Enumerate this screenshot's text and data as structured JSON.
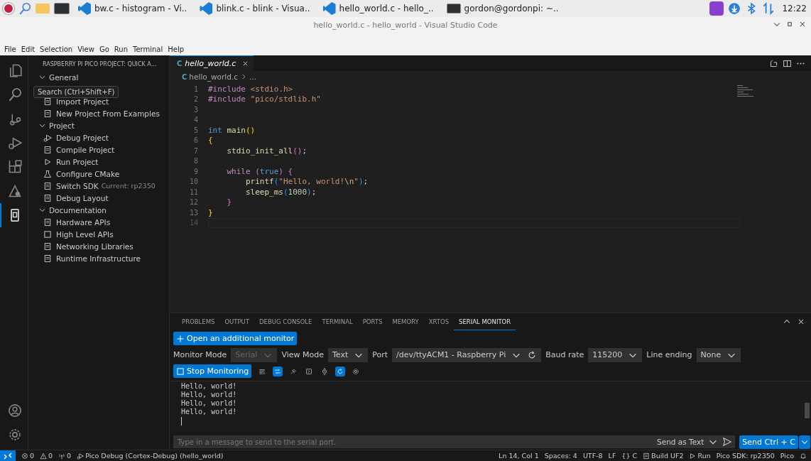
{
  "taskbar": {
    "windows": [
      {
        "kind": "vscode",
        "label": "bw.c - histogram - Vi.."
      },
      {
        "kind": "vscode",
        "label": "blink.c - blink - Visua.."
      },
      {
        "kind": "vscode",
        "label": "hello_world.c - hello_.."
      },
      {
        "kind": "terminal",
        "label": "gordon@gordonpi: ~.."
      }
    ],
    "clock": "12:22"
  },
  "window": {
    "title": "hello_world.c - hello_world - Visual Studio Code"
  },
  "menu": [
    "File",
    "Edit",
    "Selection",
    "View",
    "Go",
    "Run",
    "Terminal",
    "Help"
  ],
  "activity_bar": {
    "items": [
      {
        "selected": false
      },
      {
        "selected": false
      },
      {
        "selected": false
      },
      {
        "selected": false
      },
      {
        "selected": false
      },
      {
        "selected": false
      },
      {
        "selected": true
      }
    ],
    "tooltip": "Search (Ctrl+Shift+F)"
  },
  "sidebar": {
    "title": "RASPBERRY PI PICO PROJECT: QUICK A...",
    "sections": [
      {
        "label": "General",
        "expanded": true,
        "items": [
          {
            "label": "Import Project"
          },
          {
            "label": "New Project From Examples"
          }
        ]
      },
      {
        "label": "Project",
        "expanded": true,
        "items": [
          {
            "label": "Debug Project"
          },
          {
            "label": "Compile Project"
          },
          {
            "label": "Run Project"
          },
          {
            "label": "Configure CMake"
          },
          {
            "label": "Switch SDK",
            "detail": "Current: rp2350"
          },
          {
            "label": "Debug Layout"
          }
        ]
      },
      {
        "label": "Documentation",
        "expanded": true,
        "items": [
          {
            "label": "Hardware APIs"
          },
          {
            "label": "High Level APIs"
          },
          {
            "label": "Networking Libraries"
          },
          {
            "label": "Runtime Infrastructure"
          }
        ]
      }
    ]
  },
  "editor": {
    "tabs": [
      {
        "icon_text": "C",
        "label": "hello_world.c",
        "selected": true
      }
    ],
    "breadcrumb": {
      "icon_text": "C",
      "parts": [
        "hello_world.c",
        "..."
      ]
    },
    "lines": [
      {
        "number": "1",
        "current": false,
        "tokens": [
          {
            "kind": "directive",
            "text": "#include"
          },
          {
            "kind": "string",
            "text": " <stdio.h>"
          }
        ]
      },
      {
        "number": "2",
        "current": false,
        "tokens": [
          {
            "kind": "directive",
            "text": "#include"
          },
          {
            "kind": "string",
            "text": " \"pico/stdlib.h\""
          }
        ]
      },
      {
        "number": "3",
        "current": false
      },
      {
        "number": "4",
        "current": false
      },
      {
        "number": "5",
        "current": false,
        "tokens": [
          {
            "kind": "keyword",
            "text": "int"
          },
          {
            "kind": "function",
            "text": " main"
          },
          {
            "kind": "brace1",
            "text": "()"
          }
        ]
      },
      {
        "number": "6",
        "current": false,
        "tokens": [
          {
            "kind": "brace1",
            "text": "{"
          }
        ]
      },
      {
        "number": "7",
        "current": false,
        "tokens": [
          {
            "kind": "function",
            "text": "    stdio_init_all"
          },
          {
            "kind": "brace2",
            "text": "()"
          },
          {
            "kind": "plain",
            "text": ";"
          }
        ]
      },
      {
        "number": "8",
        "current": false
      },
      {
        "number": "9",
        "current": false,
        "tokens": [
          {
            "kind": "control",
            "text": "    while"
          },
          {
            "kind": "brace2",
            "text": " ("
          },
          {
            "kind": "keyword",
            "text": "true"
          },
          {
            "kind": "brace2",
            "text": ") {"
          }
        ]
      },
      {
        "number": "10",
        "current": false,
        "tokens": [
          {
            "kind": "function",
            "text": "        printf"
          },
          {
            "kind": "brace3",
            "text": "("
          },
          {
            "kind": "string",
            "text": "\"Hello, world!"
          },
          {
            "kind": "escape",
            "text": "\\n"
          },
          {
            "kind": "string",
            "text": "\""
          },
          {
            "kind": "brace3",
            "text": ")"
          },
          {
            "kind": "plain",
            "text": ";"
          }
        ]
      },
      {
        "number": "11",
        "current": false,
        "tokens": [
          {
            "kind": "function",
            "text": "        sleep_ms"
          },
          {
            "kind": "brace3",
            "text": "("
          },
          {
            "kind": "number",
            "text": "1000"
          },
          {
            "kind": "brace3",
            "text": ")"
          },
          {
            "kind": "plain",
            "text": ";"
          }
        ]
      },
      {
        "number": "12",
        "current": false,
        "tokens": [
          {
            "kind": "brace2",
            "text": "    }"
          }
        ]
      },
      {
        "number": "13",
        "current": false,
        "tokens": [
          {
            "kind": "brace1",
            "text": "}"
          }
        ]
      },
      {
        "number": "14",
        "current": true
      }
    ]
  },
  "panel": {
    "tabs": [
      {
        "label": "PROBLEMS",
        "selected": false
      },
      {
        "label": "OUTPUT",
        "selected": false
      },
      {
        "label": "DEBUG CONSOLE",
        "selected": false
      },
      {
        "label": "TERMINAL",
        "selected": false
      },
      {
        "label": "PORTS",
        "selected": false
      },
      {
        "label": "MEMORY",
        "selected": false
      },
      {
        "label": "XRTOS",
        "selected": false
      },
      {
        "label": "SERIAL MONITOR",
        "selected": true
      }
    ],
    "serial_monitor": {
      "open_button": "Open an additional monitor",
      "settings": [
        {
          "kind": "select",
          "label": "Monitor Mode",
          "value": "Serial",
          "disabled": true
        },
        {
          "kind": "select",
          "label": "View Mode",
          "value": "Text",
          "disabled": false
        },
        {
          "kind": "select_refresh",
          "label": "Port",
          "value": "/dev/ttyACM1 - Raspberry Pi",
          "disabled": false
        },
        {
          "kind": "select",
          "label": "Baud rate",
          "value": "115200",
          "disabled": false
        },
        {
          "kind": "select",
          "label": "Line ending",
          "value": "None",
          "disabled": false
        }
      ],
      "stop_button": "Stop Monitoring",
      "tools": [
        {
          "on": false
        },
        {
          "on": true
        },
        {
          "on": false
        },
        {
          "on": false
        },
        {
          "on": false
        },
        {
          "on": true
        },
        {
          "on": false
        }
      ],
      "output": [
        "Hello, world!",
        "Hello, world!",
        "Hello, world!",
        "Hello, world!"
      ],
      "input": {
        "placeholder": "Type in a message to send to the serial port."
      },
      "send_mode": "Send as Text",
      "send_button": "Send Ctrl + C"
    }
  },
  "status_bar": {
    "left": [
      {
        "kind": "errors",
        "text": "0"
      },
      {
        "kind": "warnings",
        "text": "0"
      },
      {
        "kind": "ports",
        "text": "0"
      },
      {
        "kind": "debug",
        "text": "Pico Debug (Cortex-Debug) (hello_world)"
      }
    ],
    "right": [
      {
        "kind": "plain",
        "text": "Ln 14, Col 1"
      },
      {
        "kind": "plain",
        "text": "Spaces: 4"
      },
      {
        "kind": "plain",
        "text": "UTF-8"
      },
      {
        "kind": "plain",
        "text": "LF"
      },
      {
        "kind": "plain",
        "text": "{} C"
      },
      {
        "kind": "build",
        "text": "Build UF2"
      },
      {
        "kind": "run",
        "text": "Run"
      },
      {
        "kind": "plain",
        "text": "Pico SDK: rp2350"
      },
      {
        "kind": "plain",
        "text": "Pico"
      }
    ]
  }
}
